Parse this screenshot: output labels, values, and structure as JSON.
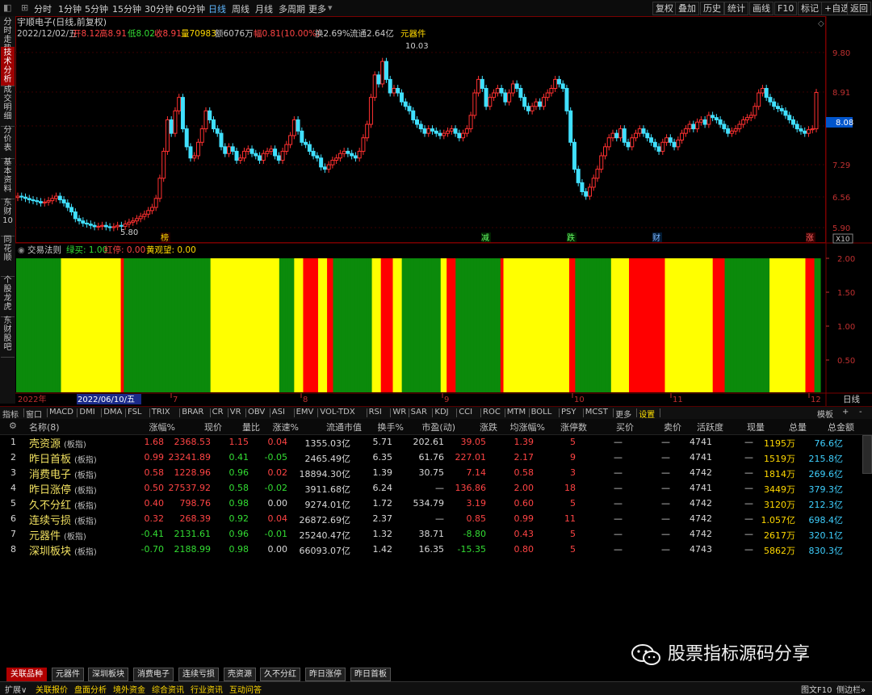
{
  "toolbar": {
    "periods": [
      "分时",
      "1分钟",
      "5分钟",
      "15分钟",
      "30分钟",
      "60分钟",
      "日线",
      "周线",
      "月线",
      "多周期",
      "更多"
    ],
    "active_period": "日线",
    "right_buttons": [
      "复权",
      "叠加",
      "历史",
      "统计",
      "画线",
      "F10",
      "标记",
      "+自选",
      "返回"
    ]
  },
  "left_tabs": [
    "分时走势",
    "技术分析",
    "成交明细",
    "分价表",
    "基本资料",
    "东财10",
    "同花顺",
    "个股龙虎",
    "东财股吧"
  ],
  "quote": {
    "name": "宇顺电子(日线,前复权)",
    "date": "2022/12/02/五",
    "open": "开8.12",
    "high": "高8.91",
    "low": "低8.02",
    "close": "收8.91",
    "volume": "量70983",
    "amount": "额6076万",
    "change": "幅0.81(10.00%)",
    "turnover": "换2.69%",
    "float": "流通2.64亿",
    "sector": "元器件"
  },
  "price_axis": [
    "9.80",
    "8.91",
    "8.08",
    "7.29",
    "6.56",
    "5.90"
  ],
  "current_price": "8.08",
  "price_high_label": "10.03",
  "price_low_label": "5.80",
  "markers": [
    "榜",
    "减",
    "跌",
    "财",
    "涨"
  ],
  "x10": "X10",
  "indicator": {
    "title": "交易法则",
    "buy": "绿买: 1.00",
    "stop": "红停: 0.00",
    "watch": "黄观望: 0.00",
    "axis": [
      "2.00",
      "1.50",
      "1.00",
      "0.50"
    ],
    "band_colors": {
      "G": "#0b8a0b",
      "Y": "#ffff00",
      "R": "#ff0000"
    },
    "band_sequence": "GGGGGGGGGGGGGGGYYYYYYYYYYYYYYYYYYYYRGGGGGGGGGGGGGGGGGGGGGGGGGGGGGYYYYYYYYYYYYYYYYYYYYYYYGGGGGYYYRRRRRYYYRRGGGGGGGGGGGGGYYYRRRRYYYGGGGGGGGGGGGGYYRRRGGGGGGGGGGGGGGGRYYYYYYYYYYYYYYYYYYYYYYRRGGGGGGGGGGGGYYYYYYRRRRRRRRRRRRYYYYYYYYYYYYYYYYRRRRGGGGGGGGGGGGGGGYYYYYYYYYYYYRRRGG"
  },
  "date_axis": {
    "year": "2022年",
    "cursor": "2022/06/10/五",
    "months": [
      "7",
      "8",
      "9",
      "10",
      "11",
      "12"
    ],
    "period": "日线"
  },
  "indicator_tabs": [
    "指标",
    "窗口",
    "MACD",
    "DMI",
    "DMA",
    "FSL",
    "TRIX",
    "BRAR",
    "CR",
    "VR",
    "OBV",
    "ASI",
    "EMV",
    "VOL-TDX",
    "RSI",
    "WR",
    "SAR",
    "KDJ",
    "CCI",
    "ROC",
    "MTM",
    "BOLL",
    "PSY",
    "MCST",
    "更多",
    "设置"
  ],
  "indicator_tabs_right": [
    "模板",
    "+",
    "-"
  ],
  "table_headers": [
    "名称(8)",
    "涨幅%",
    "现价",
    "量比",
    "涨速%",
    "流通市值",
    "换手%",
    "市盈(动)",
    "涨跌",
    "均涨幅%",
    "涨停数",
    "买价",
    "卖价",
    "活跃度",
    "现量",
    "总量",
    "总金额"
  ],
  "rows": [
    {
      "idx": "1",
      "name": "壳资源",
      "tag": "(板指)",
      "chg": "1.68",
      "price": "2368.53",
      "vr": "1.15",
      "spd": "0.04",
      "cap": "1355.03亿",
      "turn": "5.71",
      "pe": "202.61",
      "diff": "39.05",
      "avg": "1.39",
      "limit": "5",
      "bid": "—",
      "ask": "—",
      "act": "4741",
      "cur": "—",
      "vol": "1195万",
      "amt": "76.6亿",
      "sign": "up",
      "spdsign": "up"
    },
    {
      "idx": "2",
      "name": "昨日首板",
      "tag": "(板指)",
      "chg": "0.99",
      "price": "23241.89",
      "vr": "0.41",
      "spd": "-0.05",
      "cap": "2465.49亿",
      "turn": "6.35",
      "pe": "61.76",
      "diff": "227.01",
      "avg": "2.17",
      "limit": "9",
      "bid": "—",
      "ask": "—",
      "act": "4741",
      "cur": "—",
      "vol": "1519万",
      "amt": "215.8亿",
      "sign": "up",
      "spdsign": "down"
    },
    {
      "idx": "3",
      "name": "消费电子",
      "tag": "(板指)",
      "chg": "0.58",
      "price": "1228.96",
      "vr": "0.96",
      "spd": "0.02",
      "cap": "18894.30亿",
      "turn": "1.39",
      "pe": "30.75",
      "diff": "7.14",
      "avg": "0.58",
      "limit": "3",
      "bid": "—",
      "ask": "—",
      "act": "4742",
      "cur": "—",
      "vol": "1814万",
      "amt": "269.6亿",
      "sign": "up",
      "spdsign": "up"
    },
    {
      "idx": "4",
      "name": "昨日涨停",
      "tag": "(板指)",
      "chg": "0.50",
      "price": "27537.92",
      "vr": "0.58",
      "spd": "-0.02",
      "cap": "3911.68亿",
      "turn": "6.24",
      "pe": "—",
      "diff": "136.86",
      "avg": "2.00",
      "limit": "18",
      "bid": "—",
      "ask": "—",
      "act": "4741",
      "cur": "—",
      "vol": "3449万",
      "amt": "379.3亿",
      "sign": "up",
      "spdsign": "down"
    },
    {
      "idx": "5",
      "name": "久不分红",
      "tag": "(板指)",
      "chg": "0.40",
      "price": "798.76",
      "vr": "0.98",
      "spd": "0.00",
      "cap": "9274.01亿",
      "turn": "1.72",
      "pe": "534.79",
      "diff": "3.19",
      "avg": "0.60",
      "limit": "5",
      "bid": "—",
      "ask": "—",
      "act": "4742",
      "cur": "—",
      "vol": "3120万",
      "amt": "212.3亿",
      "sign": "up",
      "spdsign": "flat"
    },
    {
      "idx": "6",
      "name": "连续亏损",
      "tag": "(板指)",
      "chg": "0.32",
      "price": "268.39",
      "vr": "0.92",
      "spd": "0.04",
      "cap": "26872.69亿",
      "turn": "2.37",
      "pe": "—",
      "diff": "0.85",
      "avg": "0.99",
      "limit": "11",
      "bid": "—",
      "ask": "—",
      "act": "4742",
      "cur": "—",
      "vol": "1.057亿",
      "amt": "698.4亿",
      "sign": "up",
      "spdsign": "up"
    },
    {
      "idx": "7",
      "name": "元器件",
      "tag": "(板指)",
      "chg": "-0.41",
      "price": "2131.61",
      "vr": "0.96",
      "spd": "-0.01",
      "cap": "25240.47亿",
      "turn": "1.32",
      "pe": "38.71",
      "diff": "-8.80",
      "avg": "0.43",
      "limit": "5",
      "bid": "—",
      "ask": "—",
      "act": "4742",
      "cur": "—",
      "vol": "2617万",
      "amt": "320.1亿",
      "sign": "down",
      "spdsign": "down"
    },
    {
      "idx": "8",
      "name": "深圳板块",
      "tag": "(板指)",
      "chg": "-0.70",
      "price": "2188.99",
      "vr": "0.98",
      "spd": "0.00",
      "cap": "66093.07亿",
      "turn": "1.42",
      "pe": "16.35",
      "diff": "-15.35",
      "avg": "0.80",
      "limit": "5",
      "bid": "—",
      "ask": "—",
      "act": "4743",
      "cur": "—",
      "vol": "5862万",
      "amt": "830.3亿",
      "sign": "down",
      "spdsign": "flat"
    }
  ],
  "bottom_tabs": [
    "关联品种",
    "元器件",
    "深圳板块",
    "消费电子",
    "连续亏损",
    "壳资源",
    "久不分红",
    "昨日涨停",
    "昨日首板"
  ],
  "status": {
    "left": [
      "扩展∨",
      "关联报价",
      "盘面分析",
      "境外资金",
      "综合资讯",
      "行业资讯",
      "互动问答"
    ],
    "right1": "图文F10",
    "right2": "侧边栏»"
  },
  "watermark": "股票指标源码分享",
  "colors": {
    "up": "#ff4444",
    "down": "#33dd33",
    "candle_up": "#ff3030",
    "candle_down": "#40e0ff"
  }
}
